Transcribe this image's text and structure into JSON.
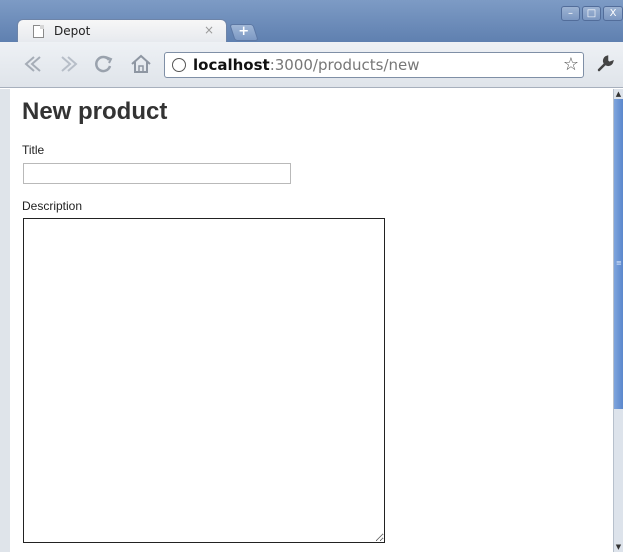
{
  "browser": {
    "tab": {
      "title": "Depot",
      "close_glyph": "×",
      "favicon": "page-icon"
    },
    "new_tab_glyph": "+",
    "window_buttons": [
      "–",
      "□",
      "X"
    ],
    "nav": {
      "back_icon": "back-icon",
      "forward_icon": "forward-icon",
      "reload_icon": "reload-icon",
      "home_icon": "home-icon"
    },
    "address": {
      "host": "localhost",
      "rest": ":3000/products/new"
    },
    "bookmark_icon": "star-icon",
    "menu_icon": "wrench-icon"
  },
  "page": {
    "heading": "New product",
    "fields": {
      "title_label": "Title",
      "title_value": "",
      "description_label": "Description",
      "description_value": ""
    }
  },
  "colors": {
    "titlebar": "#6f8fbf",
    "scroll_thumb": "#6b94d4"
  }
}
